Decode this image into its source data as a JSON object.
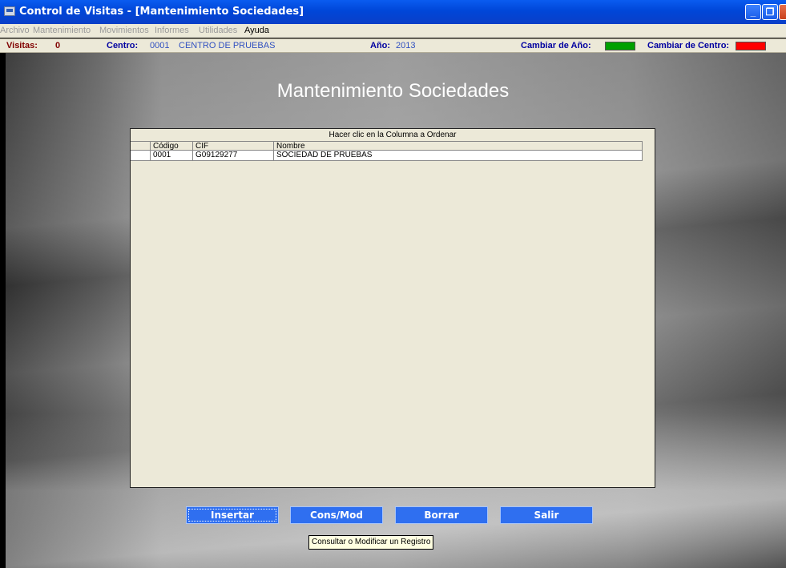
{
  "window": {
    "title": "Control de Visitas - [Mantenimiento Sociedades]",
    "icons": [
      "app-icon",
      "minimize-icon",
      "restore-icon",
      "close-icon"
    ]
  },
  "menu": {
    "items": [
      {
        "label": "Archivo",
        "enabled": false
      },
      {
        "label": "Mantenimiento",
        "enabled": false
      },
      {
        "label": "Movimientos",
        "enabled": false
      },
      {
        "label": "Informes",
        "enabled": false
      },
      {
        "label": "Utilidades",
        "enabled": false
      },
      {
        "label": "Ayuda",
        "enabled": true
      }
    ]
  },
  "status": {
    "visitas_label": "Visitas:",
    "visitas_value": "0",
    "centro_label": "Centro:",
    "centro_code": "0001",
    "centro_name": "CENTRO DE PRUEBAS",
    "anio_label": "Año:",
    "anio_value": "2013",
    "cambiar_anio_label": "Cambiar de Año:",
    "cambiar_anio_color": "#00a000",
    "cambiar_centro_label": "Cambiar de Centro:",
    "cambiar_centro_color": "#ff0000"
  },
  "main": {
    "heading": "Mantenimiento Sociedades",
    "grid": {
      "caption": "Hacer clic en la Columna a Ordenar",
      "columns": [
        "Código",
        "CIF",
        "Nombre"
      ],
      "rows": [
        [
          "0001",
          "G09129277",
          "SOCIEDAD DE PRUEBAS"
        ]
      ]
    },
    "buttons": {
      "insertar": "Insertar",
      "consmod": "Cons/Mod",
      "borrar": "Borrar",
      "salir": "Salir"
    },
    "tooltip": "Consultar o Modificar un Registro"
  }
}
